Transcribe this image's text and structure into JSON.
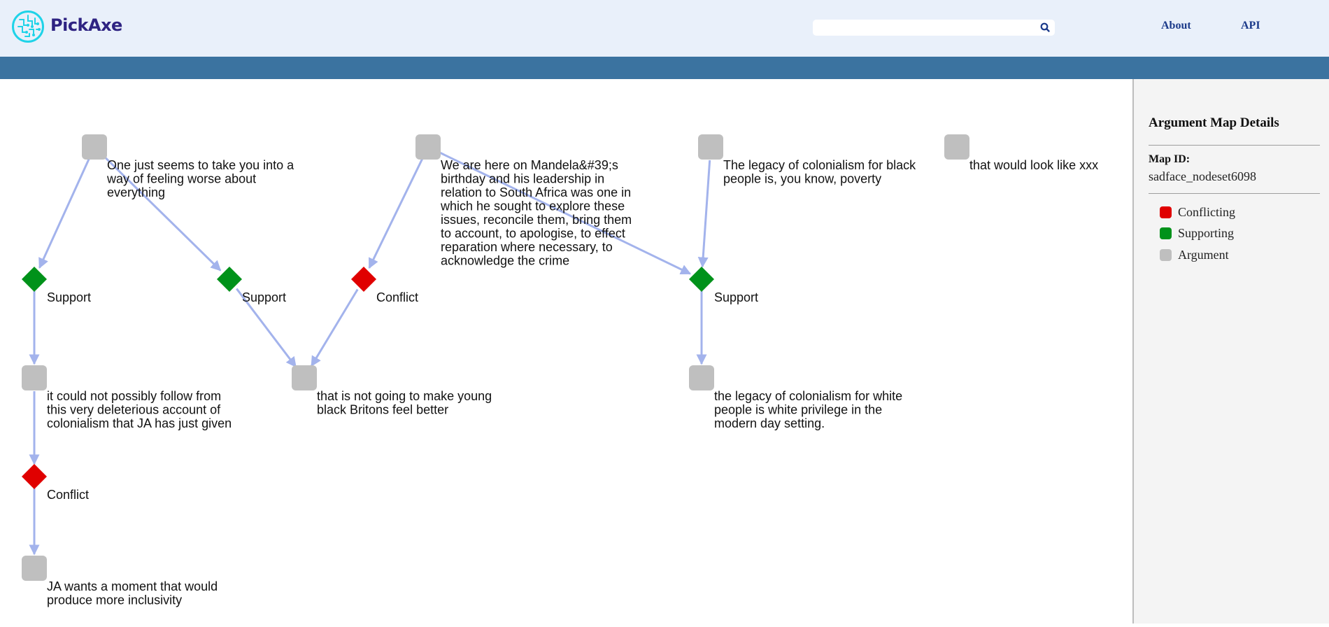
{
  "header": {
    "brand": "PickAxe",
    "search": {
      "value": "",
      "placeholder": ""
    },
    "nav": [
      {
        "label": "About"
      },
      {
        "label": "API"
      }
    ]
  },
  "sidebar": {
    "title": "Argument Map Details",
    "map_id_label": "Map ID:",
    "map_id_value": "sadface_nodeset6098",
    "legend": [
      {
        "label": "Conflicting",
        "color": "#e00000"
      },
      {
        "label": "Supporting",
        "color": "#00921a"
      },
      {
        "label": "Argument",
        "color": "#bfbfbf"
      }
    ]
  },
  "colors": {
    "argument": "#bfbfbf",
    "support": "#00921a",
    "conflict": "#e00000",
    "edge": "#a3b3ec"
  },
  "graph": {
    "nodes": [
      {
        "id": "a1",
        "type": "argument",
        "lines": [
          "One just seems to take you into a",
          "way of feeling worse about",
          "everything"
        ]
      },
      {
        "id": "a2",
        "type": "argument",
        "lines": [
          "We are here on Mandela&#39;s",
          "birthday and his leadership in",
          "relation to South Africa was one in",
          "which he sought to explore these",
          "issues, reconcile them, bring them",
          "to account, to apologise, to effect",
          "reparation where necessary, to",
          "acknowledge the crime"
        ]
      },
      {
        "id": "a3",
        "type": "argument",
        "lines": [
          "The legacy of colonialism for black",
          "people is, you know, poverty"
        ]
      },
      {
        "id": "a4",
        "type": "argument",
        "lines": [
          "that would look like xxx"
        ]
      },
      {
        "id": "s1",
        "type": "support",
        "lines": [
          "Support"
        ]
      },
      {
        "id": "s2",
        "type": "support",
        "lines": [
          "Support"
        ]
      },
      {
        "id": "c1",
        "type": "conflict",
        "lines": [
          "Conflict"
        ]
      },
      {
        "id": "s3",
        "type": "support",
        "lines": [
          "Support"
        ]
      },
      {
        "id": "a5",
        "type": "argument",
        "lines": [
          "it could not possibly follow from",
          "this very deleterious account of",
          "colonialism that JA has just given"
        ]
      },
      {
        "id": "a6",
        "type": "argument",
        "lines": [
          "that is not going to make young",
          "black Britons feel better"
        ]
      },
      {
        "id": "a7",
        "type": "argument",
        "lines": [
          "the legacy of colonialism for white",
          "people is white privilege in the",
          "modern day setting."
        ]
      },
      {
        "id": "c2",
        "type": "conflict",
        "lines": [
          "Conflict"
        ]
      },
      {
        "id": "a8",
        "type": "argument",
        "lines": [
          "JA wants a moment that would",
          "produce more inclusivity"
        ]
      }
    ],
    "edges": [
      {
        "from": "a1",
        "to": "s1"
      },
      {
        "from": "a1",
        "to": "s2"
      },
      {
        "from": "a2",
        "to": "c1"
      },
      {
        "from": "a2",
        "to": "s3"
      },
      {
        "from": "a3",
        "to": "s3"
      },
      {
        "from": "s1",
        "to": "a5"
      },
      {
        "from": "s2",
        "to": "a6"
      },
      {
        "from": "c1",
        "to": "a6"
      },
      {
        "from": "s3",
        "to": "a7"
      },
      {
        "from": "a5",
        "to": "c2"
      },
      {
        "from": "c2",
        "to": "a8"
      }
    ]
  }
}
